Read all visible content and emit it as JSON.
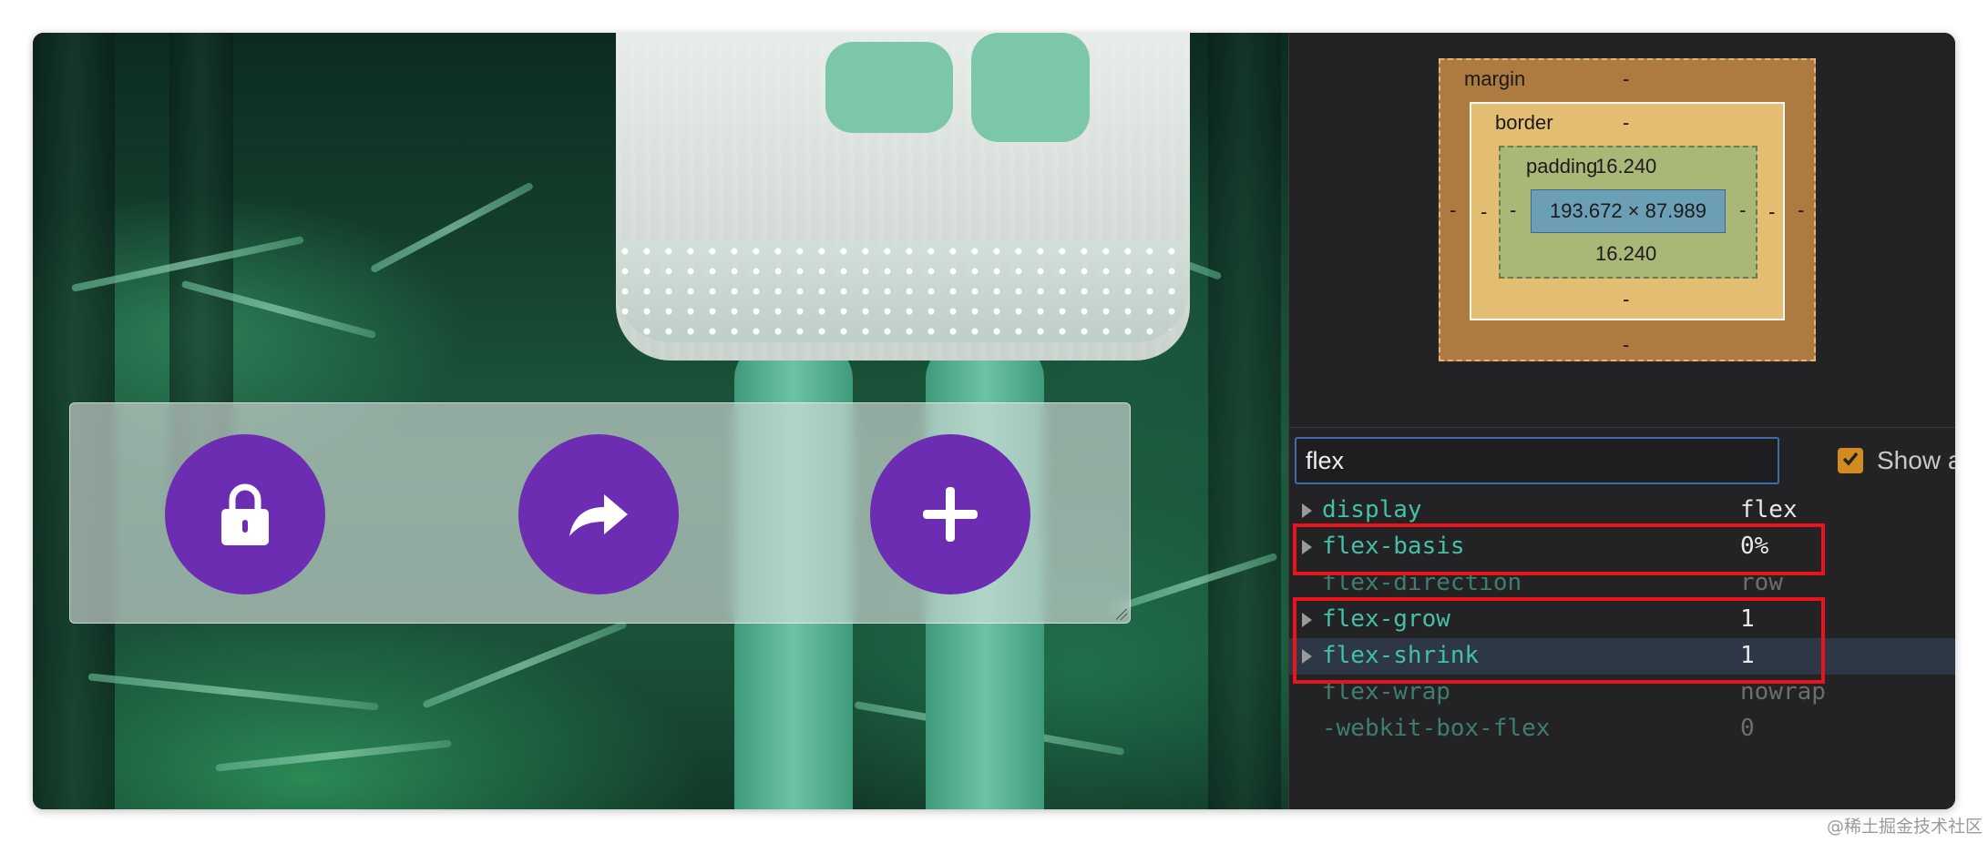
{
  "toolbar": {
    "buttons": [
      {
        "icon": "lock-icon",
        "label": "lock"
      },
      {
        "icon": "share-icon",
        "label": "share"
      },
      {
        "icon": "plus-icon",
        "label": "add"
      }
    ]
  },
  "box_model": {
    "margin_label": "margin",
    "border_label": "border",
    "padding_label": "padding",
    "margin_top": "-",
    "margin_bottom": "-",
    "margin_left": "-",
    "margin_right": "-",
    "border_top": "-",
    "border_bottom": "-",
    "border_left": "-",
    "border_right": "-",
    "padding_top": "16.240",
    "padding_bottom": "16.240",
    "padding_left": "-",
    "padding_right": "-",
    "content": "193.672 × 87.989"
  },
  "filter": {
    "value": "flex",
    "show_all_label": "Show all",
    "show_all_checked": true
  },
  "properties": [
    {
      "name": "display",
      "value": "flex",
      "inherited": false,
      "expandable": true
    },
    {
      "name": "flex-basis",
      "value": "0%",
      "inherited": false,
      "expandable": true
    },
    {
      "name": "flex-direction",
      "value": "row",
      "inherited": true,
      "expandable": false
    },
    {
      "name": "flex-grow",
      "value": "1",
      "inherited": false,
      "expandable": true
    },
    {
      "name": "flex-shrink",
      "value": "1",
      "inherited": false,
      "expandable": true
    },
    {
      "name": "flex-wrap",
      "value": "nowrap",
      "inherited": true,
      "expandable": false
    },
    {
      "name": "-webkit-box-flex",
      "value": "0",
      "inherited": true,
      "expandable": false
    }
  ],
  "colors": {
    "button_purple": "#6c2db3",
    "highlight_red": "#e8141a",
    "checkbox_orange": "#d38b1f"
  },
  "watermark": "@稀土掘金技术社区"
}
